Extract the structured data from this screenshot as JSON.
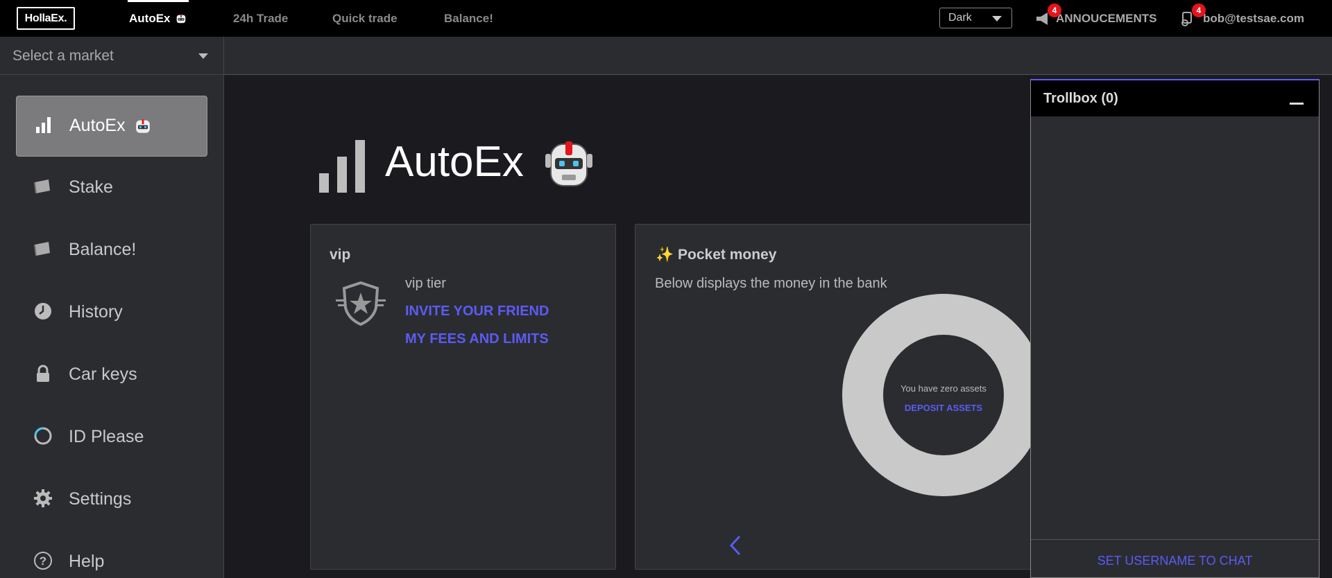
{
  "brand": {
    "logo_text": "HollaEx."
  },
  "nav": {
    "tabs": [
      {
        "label": "AutoEx",
        "active": true
      },
      {
        "label": "24h Trade"
      },
      {
        "label": "Quick trade"
      },
      {
        "label": "Balance!"
      }
    ]
  },
  "header": {
    "theme_select": "Dark",
    "announcements_label": "ANNOUCEMENTS",
    "announcements_count": "4",
    "user_email": "bob@testsae.com",
    "user_notifications": "4"
  },
  "market": {
    "placeholder": "Select a market"
  },
  "sidebar": {
    "items": [
      {
        "label": "AutoEx",
        "icon": "bar-chart-icon",
        "active": true
      },
      {
        "label": "Stake",
        "icon": "wallet-icon"
      },
      {
        "label": "Balance!",
        "icon": "wallet-icon"
      },
      {
        "label": "History",
        "icon": "clock-icon"
      },
      {
        "label": "Car keys",
        "icon": "lock-icon"
      },
      {
        "label": "ID Please",
        "icon": "spinner-icon"
      },
      {
        "label": "Settings",
        "icon": "gear-icon"
      },
      {
        "label": "Help",
        "icon": "help-icon"
      }
    ]
  },
  "main": {
    "title": "AutoEx",
    "vip_card": {
      "title": "vip",
      "tier_label": "vip tier",
      "invite_link": "INVITE YOUR FRIEND",
      "fees_link": "MY FEES AND LIMITS"
    },
    "pocket_card": {
      "emoji": "✨",
      "title": "Pocket money",
      "description": "Below displays the money in the bank",
      "zero_assets_text": "You have zero assets",
      "deposit_link": "DEPOSIT ASSETS"
    }
  },
  "trollbox": {
    "title": "Trollbox (0)",
    "set_username_link": "SET USERNAME TO CHAT"
  },
  "colors": {
    "accent": "#5b5bf5",
    "badge": "#e4141b",
    "background": "#1b1b1f",
    "panel": "#2b2c30"
  }
}
